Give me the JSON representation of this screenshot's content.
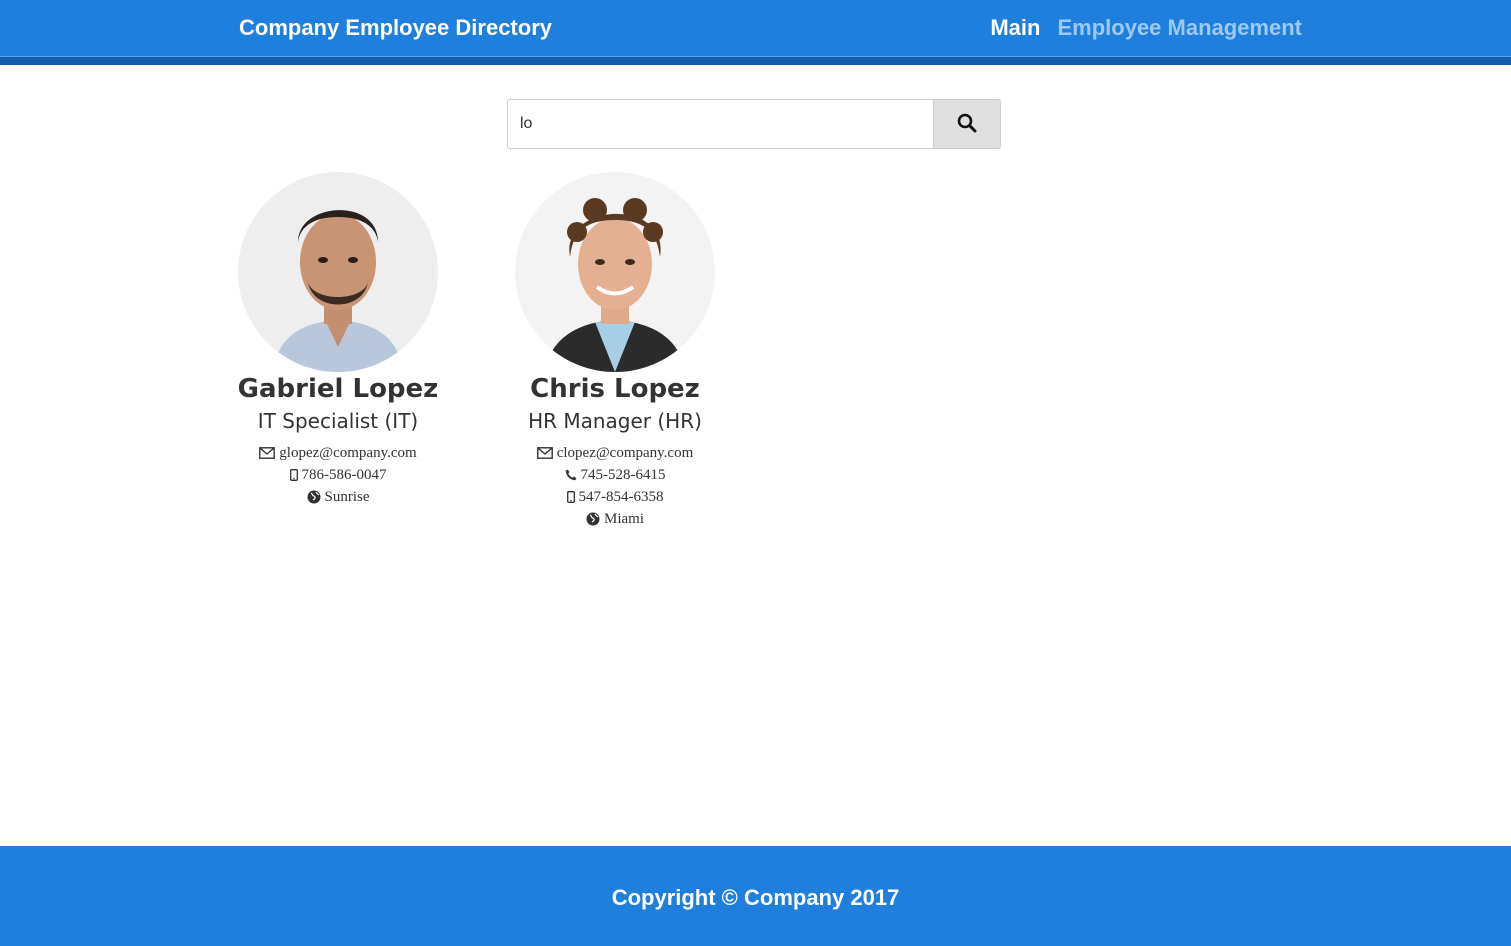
{
  "navbar": {
    "brand": "Company Employee Directory",
    "links": [
      {
        "label": "Main"
      },
      {
        "label": "Employee Management"
      }
    ]
  },
  "search": {
    "value": "lo",
    "button_icon": "search-icon"
  },
  "employees": [
    {
      "name": "Gabriel Lopez",
      "title": "IT Specialist (IT)",
      "email": "glopez@company.com",
      "mobile": "786-586-0047",
      "location": "Sunrise"
    },
    {
      "name": "Chris Lopez",
      "title": "HR Manager (HR)",
      "email": "clopez@company.com",
      "phone": "745-528-6415",
      "mobile": "547-854-6358",
      "location": "Miami"
    }
  ],
  "footer": {
    "copyright": "Copyright © Company 2017"
  },
  "colors": {
    "primary": "#1e7fdd",
    "primary_dark": "#155ea9",
    "nav_muted": "#9ccaf5",
    "text": "#333333"
  }
}
